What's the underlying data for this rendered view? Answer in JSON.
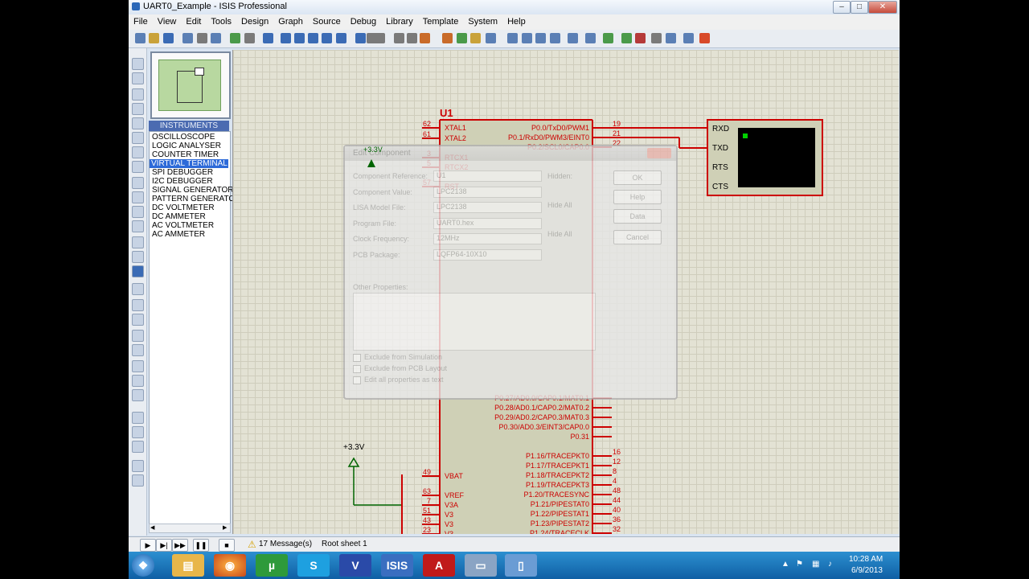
{
  "window": {
    "title": "UART0_Example - ISIS Professional"
  },
  "menu": [
    "File",
    "View",
    "Edit",
    "Tools",
    "Design",
    "Graph",
    "Source",
    "Debug",
    "Library",
    "Template",
    "System",
    "Help"
  ],
  "instruments": {
    "header": "INSTRUMENTS",
    "items": [
      "OSCILLOSCOPE",
      "LOGIC ANALYSER",
      "COUNTER TIMER",
      "VIRTUAL TERMINAL",
      "SPI DEBUGGER",
      "I2C DEBUGGER",
      "SIGNAL GENERATOR",
      "PATTERN GENERATOR",
      "DC VOLTMETER",
      "DC AMMETER",
      "AC VOLTMETER",
      "AC AMMETER"
    ],
    "selected": "VIRTUAL TERMINAL"
  },
  "schematic": {
    "chip_ref": "U1",
    "power_top": "+3.3V",
    "power_bottom": "+3.3V",
    "left_pins": [
      {
        "num": "62",
        "name": "XTAL1"
      },
      {
        "num": "61",
        "name": "XTAL2"
      },
      {
        "num": "3",
        "name": "RTCX1"
      },
      {
        "num": "5",
        "name": "RTCX2"
      },
      {
        "num": "57",
        "name": "RST"
      },
      {
        "num": "49",
        "name": "VBAT"
      },
      {
        "num": "63",
        "name": "VREF"
      },
      {
        "num": "7",
        "name": "V3A"
      },
      {
        "num": "51",
        "name": "V3"
      },
      {
        "num": "43",
        "name": "V3"
      },
      {
        "num": "23",
        "name": "V3"
      }
    ],
    "right_pins_top": [
      {
        "num": "19",
        "name": "P0.0/TxD0/PWM1"
      },
      {
        "num": "21",
        "name": "P0.1/RxD0/PWM3/EINT0"
      },
      {
        "num": "22",
        "name": "P0.2/SCL0/CAP0.0"
      }
    ],
    "right_pins_mid": [
      {
        "num": "",
        "name": "P0.27/AD0.0/CAP0.1/MAT0.1"
      },
      {
        "num": "",
        "name": "P0.28/AD0.1/CAP0.2/MAT0.2"
      },
      {
        "num": "",
        "name": "P0.29/AD0.2/CAP0.3/MAT0.3"
      },
      {
        "num": "",
        "name": "P0.30/AD0.3/EINT3/CAP0.0"
      },
      {
        "num": "",
        "name": "P0.31"
      }
    ],
    "right_pins_bottom": [
      {
        "num": "16",
        "name": "P1.16/TRACEPKT0"
      },
      {
        "num": "12",
        "name": "P1.17/TRACEPKT1"
      },
      {
        "num": "8",
        "name": "P1.18/TRACEPKT2"
      },
      {
        "num": "4",
        "name": "P1.19/TRACEPKT3"
      },
      {
        "num": "48",
        "name": "P1.20/TRACESYNC"
      },
      {
        "num": "44",
        "name": "P1.21/PIPESTAT0"
      },
      {
        "num": "40",
        "name": "P1.22/PIPESTAT1"
      },
      {
        "num": "36",
        "name": "P1.23/PIPESTAT2"
      },
      {
        "num": "32",
        "name": "P1.24/TRACECLK"
      }
    ],
    "terminal_pins": [
      "RXD",
      "TXD",
      "RTS",
      "CTS"
    ]
  },
  "dialog": {
    "title": "Edit Component",
    "fields": [
      {
        "label": "Component Reference:",
        "value": "U1"
      },
      {
        "label": "Component Value:",
        "value": "LPC2138"
      },
      {
        "label": "LISA Model File:",
        "value": "LPC2138"
      },
      {
        "label": "Program File:",
        "value": "UART0.hex"
      },
      {
        "label": "Clock Frequency:",
        "value": "12MHz"
      },
      {
        "label": "PCB Package:",
        "value": "LQFP64-10X10"
      }
    ],
    "other_props_label": "Other Properties:",
    "checkboxes": [
      "Exclude from Simulation",
      "Exclude from PCB Layout",
      "Edit all properties as text"
    ],
    "side_checks": [
      "Hidden:",
      "Hide All",
      "Hide All"
    ],
    "buttons": [
      "OK",
      "Help",
      "Data",
      "Cancel"
    ]
  },
  "statusbar": {
    "messages": "17 Message(s)",
    "sheet": "Root sheet 1"
  },
  "taskbar": {
    "time": "10:28 AM",
    "date": "6/9/2013"
  }
}
